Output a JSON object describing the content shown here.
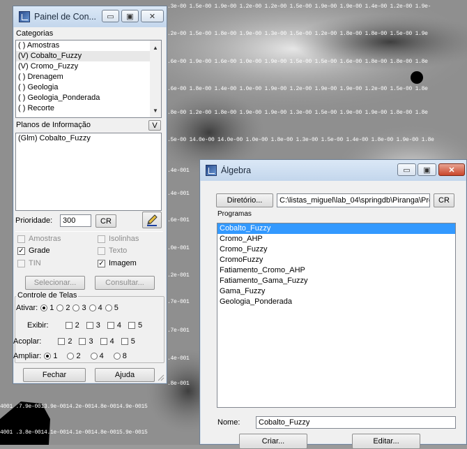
{
  "background": {
    "row_labels": [
      ".3e-00 1.5e-00 1.9e-00 1.2e-00 1.2e-00 1.5e-00 1.9e-00 1.9e-00 1.4e-00 1.2e-00 1.9e-",
      ".2e-00 1.5e-00 1.8e-00 1.9e-00 1.3e-00 1.5e-00 1.2e-00 1.8e-00 1.8e-00 1.5e-00 1.9e",
      ".6e-00 1.9e-00 1.6e-00 1.0e-00 1.9e-00 1.5e-00 1.5e-00 1.6e-00 1.8e-00 1.8e-00 1.8e",
      ".6e-00 1.8e-00 1.4e-00 1.0e-00 1.9e-00 1.2e-00 1.9e-00 1.9e-00 1.2e-00 1.5e-00 1.8e",
      ".8e-00 1.2e-00 1.8e-00 1.9e-00 1.9e-00 1.3e-00 1.5e-00 1.9e-00 1.9e-00 1.8e-00 1.8e",
      ".5e-00 14.0e-00 14.0e-00 1.0e-00 1.8e-00 1.3e-00 1.5e-00 1.4e-00 1.8e-00 1.9e-00 1.8e"
    ],
    "left_labels": [
      ".4e-001",
      ".4e-001",
      ".6e-001",
      ".0e-001",
      ".2e-001",
      ".7e-001",
      ".7e-001",
      ".4e-001",
      ".8e-001"
    ],
    "bottom_labels": [
      "4001  .7.9e-0013.9e-0014.2e-0014.8e-0014.9e-0015",
      "4001  .3.8e-0014.1e-0014.1e-0014.8e-0015.9e-0015"
    ]
  },
  "painel": {
    "title": "Painel de Con...",
    "categorias_label": "Categorias",
    "categorias": [
      "( ) Amostras",
      "(V) Cobalto_Fuzzy",
      "(V) Cromo_Fuzzy",
      "( ) Drenagem",
      "( ) Geologia",
      "( ) Geologia_Ponderada",
      "( ) Recorte"
    ],
    "planos_label": "Planos de Informação",
    "planos_button": "V",
    "planos": [
      "(Glm) Cobalto_Fuzzy"
    ],
    "prioridade_label": "Prioridade:",
    "prioridade_value": "300",
    "cr_label": "CR",
    "options": {
      "amostras": "Amostras",
      "isolinhas": "Isolinhas",
      "grade": "Grade",
      "texto": "Texto",
      "tin": "TIN",
      "imagem": "Imagem"
    },
    "selecionar": "Selecionar...",
    "consultar": "Consultar...",
    "controle_label": "Controle de Telas",
    "ativar_label": "Ativar:",
    "exibir_label": "Exibir:",
    "acoplar_label": "Acoplar:",
    "ampliar_label": "Ampliar:",
    "nums": [
      "1",
      "2",
      "3",
      "4",
      "5"
    ],
    "ampliar_nums": [
      "1",
      "2",
      "4",
      "8"
    ],
    "fechar": "Fechar",
    "ajuda": "Ajuda"
  },
  "algebra": {
    "title": "Álgebra",
    "diretorio_button": "Diretório...",
    "diretorio_value": "C:\\listas_miguel\\lab_04\\springdb\\Piranga\\Pro",
    "cr_label": "CR",
    "programas_label": "Programas",
    "programas": [
      "Cobalto_Fuzzy",
      "Cromo_AHP",
      "Cromo_Fuzzy",
      "CromoFuzzy",
      "Fatiamento_Cromo_AHP",
      "Fatiamento_Gama_Fuzzy",
      "Gama_Fuzzy",
      "Geologia_Ponderada"
    ],
    "nome_label": "Nome:",
    "nome_value": "Cobalto_Fuzzy",
    "criar": "Criar...",
    "editar": "Editar..."
  },
  "colors": {
    "selection": "#3399ff",
    "window_bg": "#f0f0f0",
    "title_gradient_top": "#dbe8f6",
    "close_red": "#c9462b"
  }
}
